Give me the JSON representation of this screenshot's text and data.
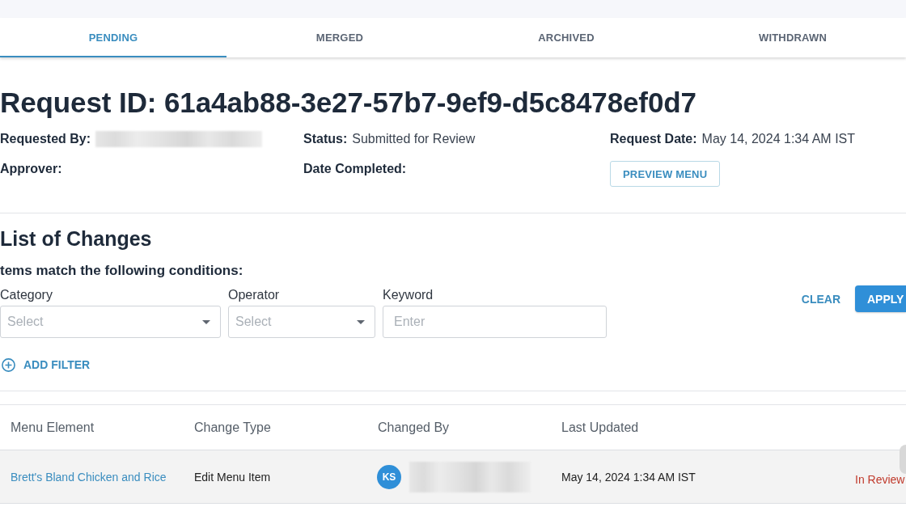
{
  "tabs": [
    {
      "label": "PENDING",
      "selected": true
    },
    {
      "label": "MERGED",
      "selected": false
    },
    {
      "label": "ARCHIVED",
      "selected": false
    },
    {
      "label": "WITHDRAWN",
      "selected": false
    }
  ],
  "request": {
    "title": "Request ID: 61a4ab88-3e27-57b7-9ef9-d5c8478ef0d7",
    "fields": [
      {
        "label": "Requested By:",
        "redacted": true
      },
      {
        "label": "Status:",
        "value": "Submitted for Review"
      },
      {
        "label": "Request Date:",
        "value": "May 14, 2024 1:34 AM IST"
      },
      {
        "label": "Approver:"
      },
      {
        "label": "Date Completed:"
      }
    ],
    "preview_button": "PREVIEW MENU"
  },
  "changes": {
    "title": "List of Changes",
    "conditions_text": "tems match the following conditions:",
    "filters": [
      {
        "label": "Category",
        "kind": "select",
        "placeholder": "Select"
      },
      {
        "label": "Operator",
        "kind": "select",
        "placeholder": "Select"
      },
      {
        "label": "Keyword",
        "kind": "text",
        "placeholder": "Enter"
      }
    ],
    "clear_button": "CLEAR",
    "apply_button": "APPLY",
    "add_filter_button": "ADD FILTER"
  },
  "table": {
    "columns": [
      "Menu Element",
      "Change Type",
      "Changed By",
      "Last Updated"
    ],
    "rows": [
      {
        "menu_element": "Brett's Bland Chicken and Rice",
        "change_type": "Edit Menu Item",
        "changed_by": {
          "initials": "KS",
          "redacted": true
        },
        "last_updated": "May 14, 2024 1:34 AM IST",
        "status": "In Review"
      }
    ]
  }
}
